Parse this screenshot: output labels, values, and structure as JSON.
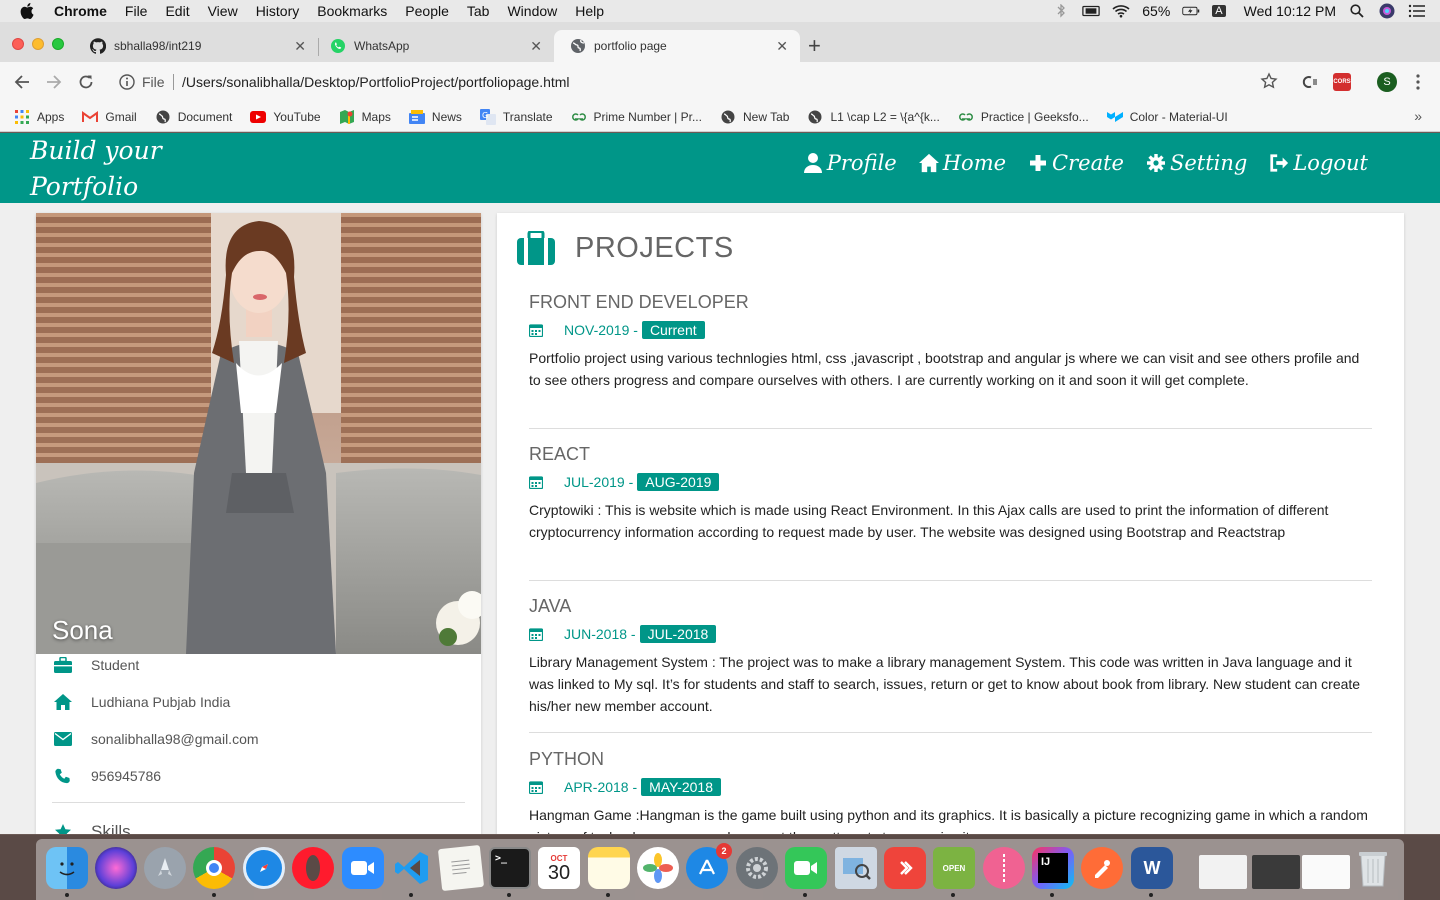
{
  "menubar": {
    "app": "Chrome",
    "items": [
      "File",
      "Edit",
      "View",
      "History",
      "Bookmarks",
      "People",
      "Tab",
      "Window",
      "Help"
    ],
    "battery": "65%",
    "input_source": "A",
    "clock": "Wed 10:12 PM"
  },
  "tabs": [
    {
      "title": "sbhalla98/int219",
      "icon": "github-icon"
    },
    {
      "title": "WhatsApp",
      "icon": "whatsapp-icon"
    },
    {
      "title": "portfolio page",
      "icon": "globe-icon"
    }
  ],
  "address": {
    "scheme": "File",
    "url": "/Users/sonalibhalla/Desktop/PortfolioProject/portfoliopage.html"
  },
  "profile_avatar_letter": "S",
  "cors_label": "CORS",
  "bookmarks": [
    {
      "label": "Apps",
      "icon": "apps-grid-icon"
    },
    {
      "label": "Gmail",
      "icon": "gmail-icon"
    },
    {
      "label": "Document",
      "icon": "globe-icon"
    },
    {
      "label": "YouTube",
      "icon": "youtube-icon"
    },
    {
      "label": "Maps",
      "icon": "maps-icon"
    },
    {
      "label": "News",
      "icon": "news-icon"
    },
    {
      "label": "Translate",
      "icon": "translate-icon"
    },
    {
      "label": "Prime Number | Pr...",
      "icon": "geeksforgeeks-icon"
    },
    {
      "label": "New Tab",
      "icon": "globe-icon"
    },
    {
      "label": "L1 \\cap L2 = \\{a^{k...",
      "icon": "globe-icon"
    },
    {
      "label": "Practice | Geeksfo...",
      "icon": "geeksforgeeks-icon"
    },
    {
      "label": "Color - Material-UI",
      "icon": "material-ui-icon"
    }
  ],
  "site": {
    "brand_line1": "Build your",
    "brand_line2": "Portfolio",
    "nav": [
      {
        "label": "Profile",
        "icon": "user-icon"
      },
      {
        "label": "Home",
        "icon": "home-icon"
      },
      {
        "label": "Create",
        "icon": "plus-icon"
      },
      {
        "label": "Setting",
        "icon": "gear-icon"
      },
      {
        "label": "Logout",
        "icon": "logout-icon"
      }
    ]
  },
  "profile": {
    "name": "Sona",
    "occupation": "Student",
    "location": "Ludhiana Pubjab India",
    "email": "sonalibhalla98@gmail.com",
    "phone": "956945786",
    "skills_heading": "Skills"
  },
  "projects": {
    "heading": "PROJECTS",
    "items": [
      {
        "title": "FRONT END DEVELOPER",
        "start": "NOV-2019 -",
        "end": "Current",
        "description": "Portfolio project using various technlogies html, css ,javascript , bootstrap and angular js where we can visit and see others profile and to see others progress and compare ourselves with others. I are currently working on it and soon it will get complete."
      },
      {
        "title": "REACT",
        "start": "JUL-2019 -",
        "end": "AUG-2019",
        "description": "Cryptowiki : This is website which is made using React Environment. In this Ajax calls are used to print the information of different cryptocurrency information according to request made by user. The website was designed using Bootstrap and Reactstrap"
      },
      {
        "title": "JAVA",
        "start": "JUN-2018 -",
        "end": "JUL-2018",
        "description": "Library Management System : The project was to make a library management System. This code was written in Java language and it was linked to My sql. It’s for students and staff to search, issues, return or get to know about book from library. New student can create his/her new member account."
      },
      {
        "title": "PYTHON",
        "start": "APR-2018 -",
        "end": "MAY-2018",
        "description": "Hangman Game :Hangman is the game built using python and its graphics. It is basically a picture recognizing game in which a random picture of technology comes and user get three attempts to recognize it."
      }
    ]
  },
  "dock": {
    "calendar_month": "OCT",
    "calendar_day": "30",
    "appstore_badge": "2",
    "terminal_prompt": ">_",
    "word_letter": "W",
    "intellij_letters": "IJ",
    "open_sign": "OPEN",
    "apps": [
      "finder-icon",
      "siri-icon",
      "launchpad-icon",
      "chrome-icon",
      "safari-icon",
      "opera-icon",
      "zoom-icon",
      "vscode-icon",
      "textedit-icon",
      "terminal-icon",
      "calendar-icon",
      "notes-icon",
      "photos-icon",
      "appstore-icon",
      "system-preferences-icon",
      "facetime-icon",
      "preview-icon",
      "anydesk-icon",
      "open-sign-icon",
      "archive-icon",
      "intellij-icon",
      "postman-icon",
      "word-icon",
      "window-thumb-1",
      "window-thumb-2",
      "window-thumb-3",
      "trash-icon"
    ]
  },
  "colors": {
    "accent": "#009688",
    "menubar": "#e9e9e9",
    "tab_bg": "#dedede"
  }
}
